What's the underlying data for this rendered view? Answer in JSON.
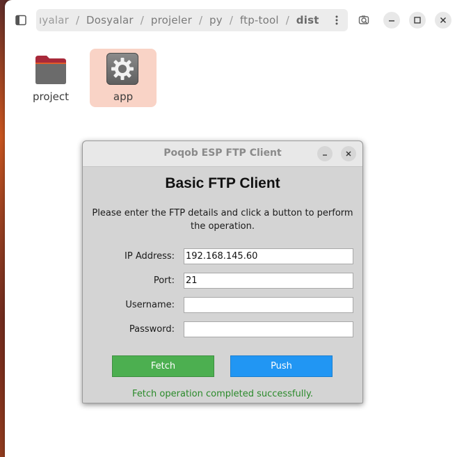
{
  "file_manager": {
    "breadcrumbs": [
      "ıyalar",
      "Dosyalar",
      "projeler",
      "py",
      "ftp-tool",
      "dist"
    ],
    "files": [
      {
        "name": "project",
        "type": "folder"
      },
      {
        "name": "app",
        "type": "executable"
      }
    ],
    "icons": {
      "sidebar": "sidebar-toggle-icon",
      "menu": "more-vertical-icon",
      "search": "search-icon",
      "minimize": "minimize-icon",
      "maximize": "maximize-icon",
      "close": "close-icon"
    },
    "colors": {
      "selection": "#f9d3c6",
      "folder": "#6b6b6b",
      "folder_tab": "#c0392b"
    }
  },
  "dialog": {
    "title": "Poqob ESP FTP Client",
    "heading": "Basic FTP Client",
    "instructions": "Please enter the FTP details and click a button to perform the operation.",
    "fields": {
      "ip": {
        "label": "IP Address:",
        "value": "192.168.145.60"
      },
      "port": {
        "label": "Port:",
        "value": "21"
      },
      "username": {
        "label": "Username:",
        "value": ""
      },
      "password": {
        "label": "Password:",
        "value": ""
      }
    },
    "buttons": {
      "fetch": "Fetch",
      "push": "Push"
    },
    "status": "Fetch operation completed successfully.",
    "colors": {
      "fetch": "#4caf50",
      "push": "#2196f3",
      "status": "#2a8a2a"
    }
  }
}
